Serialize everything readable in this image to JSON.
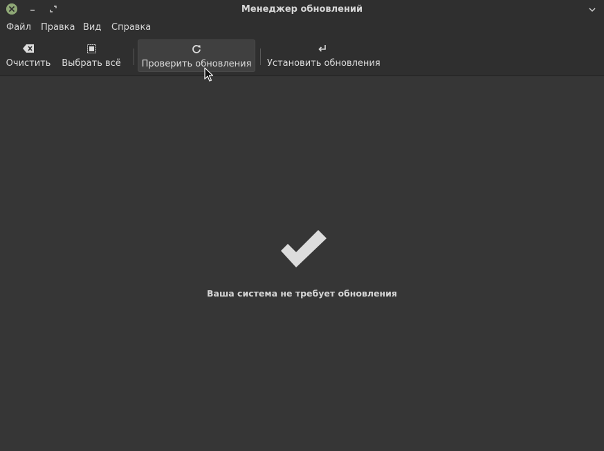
{
  "window": {
    "title": "Менеджер обновлений"
  },
  "menubar": {
    "items": [
      "Файл",
      "Правка",
      "Вид",
      "Справка"
    ]
  },
  "toolbar": {
    "clear_label": "Очистить",
    "clear_icon": "backspace-icon",
    "select_all_label": "Выбрать всё",
    "select_all_icon": "select-all-icon",
    "refresh_label": "Проверить обновления",
    "refresh_icon": "refresh-icon",
    "install_label": "Установить обновления",
    "install_icon": "enter-arrow-icon"
  },
  "main": {
    "status_icon": "checkmark-icon",
    "status_text": "Ваша система не требует обновления"
  },
  "colors": {
    "background": "#363636",
    "chrome": "#2f2f2f",
    "close_button": "#8fa876",
    "text": "#d8d8d8"
  }
}
